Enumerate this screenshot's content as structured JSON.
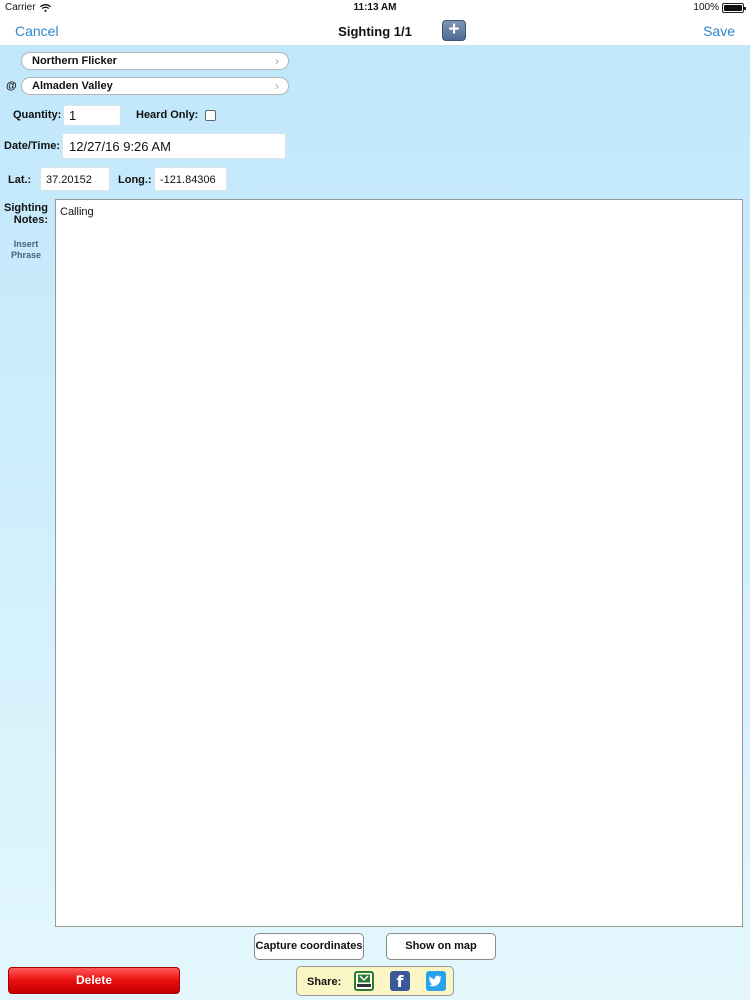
{
  "status_bar": {
    "carrier": "Carrier",
    "time": "11:13 AM",
    "battery": "100%",
    "battery_level": 1.0
  },
  "nav": {
    "cancel_label": "Cancel",
    "title": "Sighting 1/1",
    "add_label": "+",
    "save_label": "Save"
  },
  "species": {
    "value": "Northern Flicker"
  },
  "location": {
    "prefix": "@",
    "value": "Almaden Valley"
  },
  "quantity": {
    "label": "Quantity:",
    "value": "1"
  },
  "heard_only": {
    "label": "Heard Only:",
    "checked": false
  },
  "datetime": {
    "label": "Date/Time:",
    "value": "12/27/16 9:26 AM"
  },
  "coords": {
    "lat_label": "Lat.:",
    "lat_value": "37.20152",
    "long_label": "Long.:",
    "long_value": "-121.84306"
  },
  "notes": {
    "label_line1": "Sighting",
    "label_line2": "Notes:",
    "value": "Calling",
    "insert_line1": "Insert",
    "insert_line2": "Phrase"
  },
  "buttons": {
    "capture": "Capture coordinates",
    "show_map": "Show on map",
    "delete": "Delete"
  },
  "share": {
    "label": "Share:",
    "services": [
      "listserv",
      "facebook",
      "twitter"
    ]
  },
  "colors": {
    "accent": "#2f86c9",
    "delete": "#e90f0f",
    "share_bg": "#fbf6c6",
    "facebook": "#3b5998",
    "twitter": "#1da1f2"
  }
}
